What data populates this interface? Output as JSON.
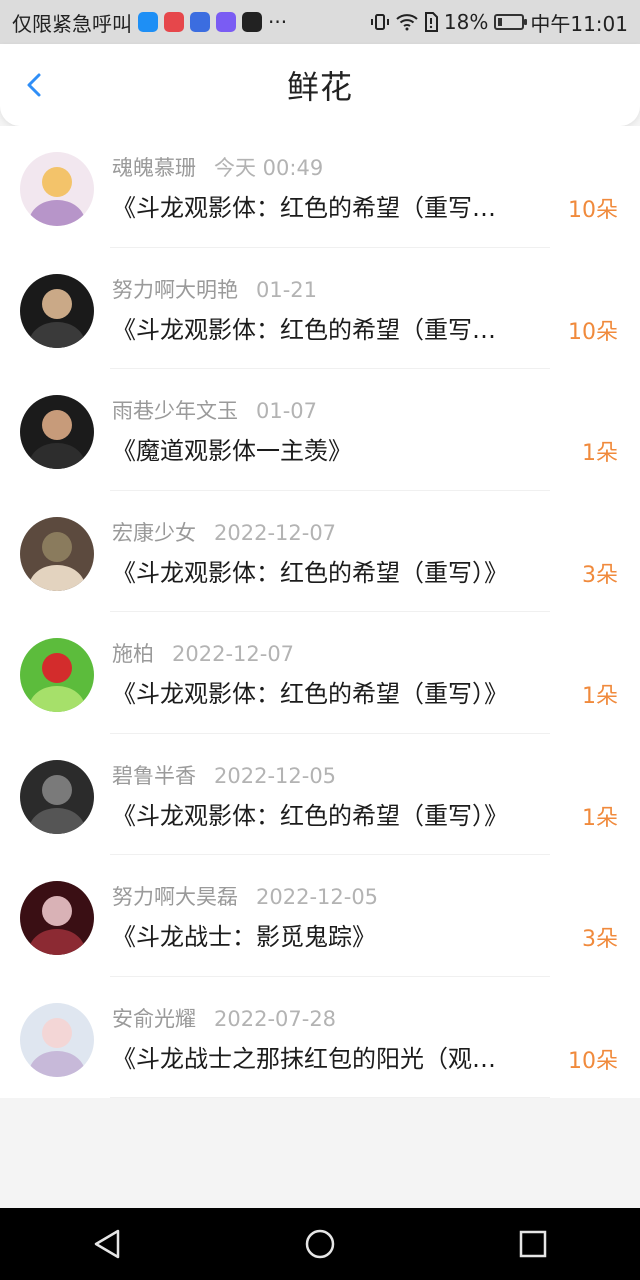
{
  "status_bar": {
    "left_text": "仅限紧急呼叫",
    "app_icons": [
      {
        "name": "zhihu-icon",
        "label": "知乎",
        "color": "#1e8ff5"
      },
      {
        "name": "weibo-icon",
        "label": "",
        "color": "#e6474b"
      },
      {
        "name": "baidu-icon",
        "label": "",
        "color": "#3b6de0"
      },
      {
        "name": "chat-icon",
        "label": "",
        "color": "#7a5cf3"
      },
      {
        "name": "tiktok-icon",
        "label": "",
        "color": "#222222"
      }
    ],
    "more": "···",
    "battery": "18%",
    "battery_level": 0.18,
    "time": "中午11:01"
  },
  "header": {
    "title": "鲜花",
    "back_icon": "chevron-left-icon",
    "accent": "#2f8ef7"
  },
  "items": [
    {
      "user": "魂魄慕珊",
      "date": "今天 00:49",
      "book": "《斗龙观影体：红色的希望（重写…",
      "count": "10朵",
      "avatar_colors": [
        "#f2e7ef",
        "#b795c9",
        "#f3c36a"
      ]
    },
    {
      "user": "努力啊大明艳",
      "date": "01-21",
      "book": "《斗龙观影体：红色的希望（重写…",
      "count": "10朵",
      "avatar_colors": [
        "#1a1a1a",
        "#3a3a3a",
        "#caa987"
      ]
    },
    {
      "user": "雨巷少年文玉",
      "date": "01-07",
      "book": "《魔道观影体一主羡》",
      "count": "1朵",
      "avatar_colors": [
        "#1b1b1b",
        "#2d2d2d",
        "#c79b7a"
      ]
    },
    {
      "user": "宏康少女",
      "date": "2022-12-07",
      "book": "《斗龙观影体：红色的希望（重写）》",
      "count": "3朵",
      "avatar_colors": [
        "#5c4a3e",
        "#e3d3bf",
        "#8a7b5d"
      ]
    },
    {
      "user": "施柏",
      "date": "2022-12-07",
      "book": "《斗龙观影体：红色的希望（重写）》",
      "count": "1朵",
      "avatar_colors": [
        "#5cbc3c",
        "#a6e06a",
        "#d32c2c"
      ]
    },
    {
      "user": "碧鲁半香",
      "date": "2022-12-05",
      "book": "《斗龙观影体：红色的希望（重写）》",
      "count": "1朵",
      "avatar_colors": [
        "#2b2b2b",
        "#555555",
        "#7a7a7a"
      ]
    },
    {
      "user": "努力啊大昊磊",
      "date": "2022-12-05",
      "book": "《斗龙战士：影觅鬼踪》",
      "count": "3朵",
      "avatar_colors": [
        "#3a0f14",
        "#8c2a33",
        "#d9b2b6"
      ]
    },
    {
      "user": "安俞光耀",
      "date": "2022-07-28",
      "book": "《斗龙战士之那抹红包的阳光（观…",
      "count": "10朵",
      "avatar_colors": [
        "#dfe6f0",
        "#c7b9d9",
        "#f3d6d6"
      ]
    }
  ],
  "nav": {
    "back_icon": "triangle-back-icon",
    "home_icon": "circle-home-icon",
    "recent_icon": "square-recent-icon"
  }
}
